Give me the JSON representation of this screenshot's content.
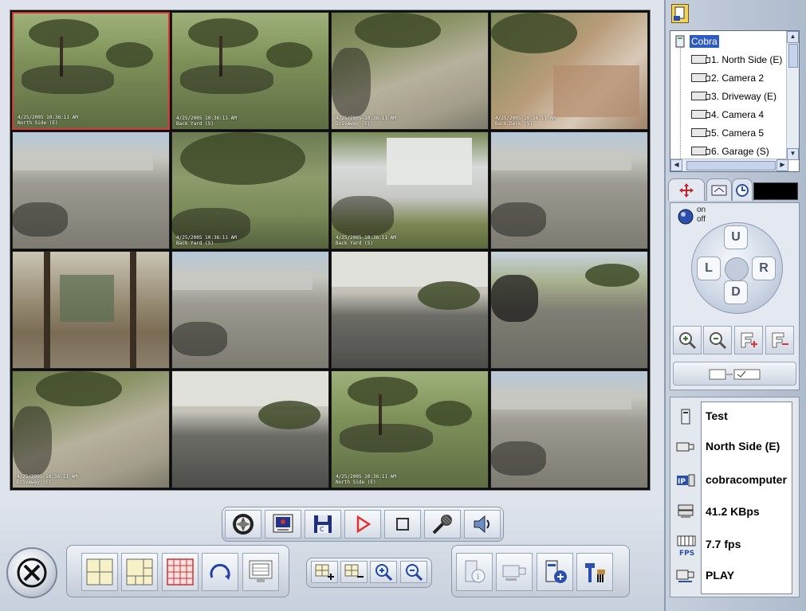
{
  "video_grid": {
    "cameras": [
      {
        "date": "4/25/2005 10:36:11 AM",
        "name": "North Side (E)",
        "scene": "lawn",
        "selected": true
      },
      {
        "date": "4/25/2005 10:36:11 AM",
        "name": "Back Yard (S)",
        "scene": "lawn"
      },
      {
        "date": "4/25/2005 10:36:11 AM",
        "name": "Driveway (E)",
        "scene": "drive"
      },
      {
        "date": "4/25/2005 10:36:11 AM",
        "name": "Back Deck (S)",
        "scene": "deck"
      },
      {
        "date": "",
        "name": "",
        "scene": "lot"
      },
      {
        "date": "4/25/2005 10:36:11 AM",
        "name": "Back Yard (S)",
        "scene": "yard"
      },
      {
        "date": "4/25/2005 10:36:11 AM",
        "name": "Back Yard (S)",
        "scene": "shed"
      },
      {
        "date": "",
        "name": "",
        "scene": "lot"
      },
      {
        "date": "",
        "name": "",
        "scene": "shop"
      },
      {
        "date": "",
        "name": "",
        "scene": "lot"
      },
      {
        "date": "",
        "name": "",
        "scene": "house"
      },
      {
        "date": "",
        "name": "",
        "scene": "road"
      },
      {
        "date": "4/25/2005 10:36:11 AM",
        "name": "Driveway (E)",
        "scene": "drive"
      },
      {
        "date": "",
        "name": "",
        "scene": "house"
      },
      {
        "date": "4/25/2005 10:36:11 AM",
        "name": "North Side (E)",
        "scene": "lawn"
      },
      {
        "date": "",
        "name": "",
        "scene": "lot"
      }
    ]
  },
  "camera_tree": {
    "root": "Cobra",
    "items": [
      "1. North Side (E)",
      "2. Camera 2",
      "3. Driveway (E)",
      "4. Camera 4",
      "5. Camera 5",
      "6. Garage (S)"
    ]
  },
  "ptz": {
    "on_label": "on",
    "off_label": "off",
    "up": "U",
    "down": "D",
    "left": "L",
    "right": "R"
  },
  "status": {
    "server": "Test",
    "camera": "North Side (E)",
    "host": "cobracomputer",
    "bitrate": "41.2 KBps",
    "framerate": "7.7 fps",
    "mode": "PLAY",
    "fps_icon_label": "FPS",
    "ip_icon_label": "IP"
  },
  "colors": {
    "selected_border": "#e03434",
    "tree_highlight": "#2d5bbf",
    "record_red": "#e53030",
    "accent_blue": "#2244aa"
  },
  "icons": {
    "exit": "close-circle-icon",
    "record_play": "play-icon",
    "stop": "stop-icon"
  }
}
